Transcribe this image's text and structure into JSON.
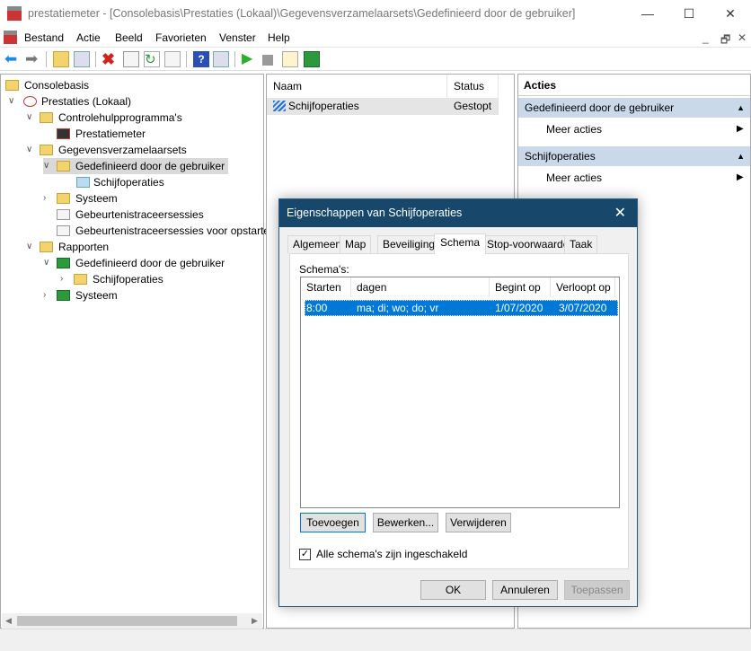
{
  "window": {
    "title": "prestatiemeter - [Consolebasis\\Prestaties (Lokaal)\\Gegevensverzamelaarsets\\Gedefinieerd door de gebruiker]",
    "minimize": "—",
    "maximize": "☐",
    "close": "✕"
  },
  "menu": [
    "Bestand",
    "Actie",
    "Beeld",
    "Favorieten",
    "Venster",
    "Help"
  ],
  "mdi": {
    "min": "_",
    "restore": "🗗",
    "close": "✕"
  },
  "tree": [
    "Consolebasis",
    "Prestaties (Lokaal)",
    "Controlehulpprogramma's",
    "Prestatiemeter",
    "Gegevensverzamelaarsets",
    "Gedefinieerd door de gebruiker",
    "Schijfoperaties",
    "Systeem",
    "Gebeurtenistraceersessies",
    "Gebeurtenistraceersessies voor opstarten",
    "Rapporten",
    "Gedefinieerd door de gebruiker",
    "Schijfoperaties",
    "Systeem"
  ],
  "middle": {
    "headers": [
      "Naam",
      "Status"
    ],
    "rows": [
      {
        "name": "Schijfoperaties",
        "status": "Gestopt"
      }
    ]
  },
  "actions": {
    "title": "Acties",
    "sections": [
      {
        "header": "Gedefinieerd door de gebruiker",
        "item": "Meer acties"
      },
      {
        "header": "Schijfoperaties",
        "item": "Meer acties"
      }
    ]
  },
  "dialog": {
    "title": "Eigenschappen van Schijfoperaties",
    "tabs": [
      "Algemeen",
      "Map",
      "Beveiliging",
      "Schema",
      "Stop-voorwaarde",
      "Taak"
    ],
    "active_tab": "Schema",
    "list_label": "Schema's:",
    "columns": [
      "Starten",
      "dagen",
      "Begint op",
      "Verloopt op"
    ],
    "rows": [
      [
        "8:00",
        "ma; di; wo; do; vr",
        "1/07/2020",
        "3/07/2020"
      ]
    ],
    "buttons": {
      "add": "Toevoegen",
      "edit": "Bewerken...",
      "remove": "Verwijderen"
    },
    "checkbox": {
      "label": "Alle schema's zijn ingeschakeld",
      "checked": true
    },
    "footer": {
      "ok": "OK",
      "cancel": "Annuleren",
      "apply": "Toepassen"
    }
  },
  "colors": {
    "accent": "#17476b",
    "selection": "#0078d7",
    "action_header": "#c9d9ea"
  }
}
